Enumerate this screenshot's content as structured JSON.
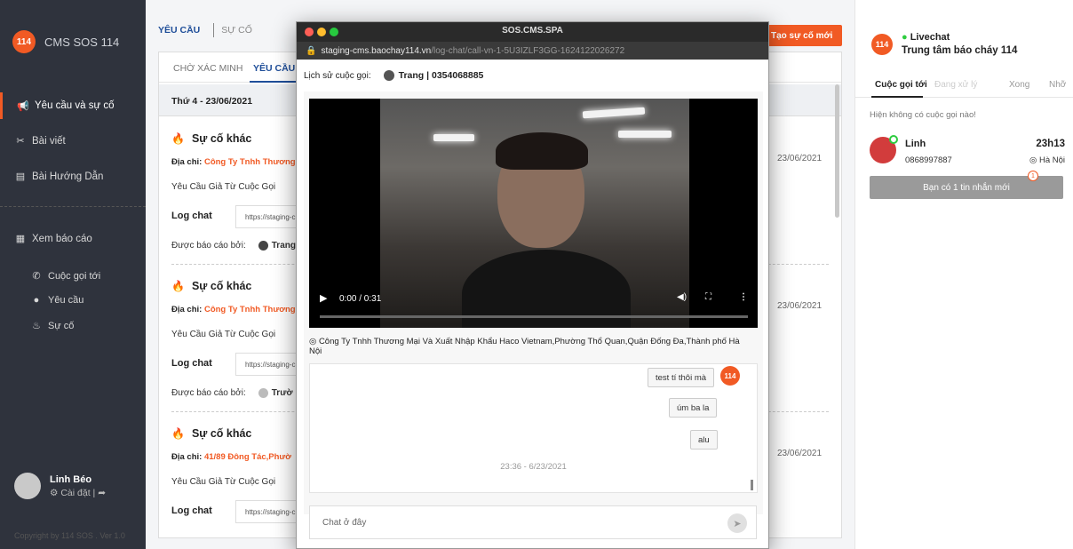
{
  "sidebar": {
    "logo_badge": "114",
    "logo_text": "CMS SOS 114",
    "items": [
      {
        "label": "Yêu cầu và sự cố",
        "icon": "megaphone-icon"
      },
      {
        "label": "Bài viết",
        "icon": "tools-icon"
      },
      {
        "label": "Bài Hướng Dẫn",
        "icon": "document-icon"
      },
      {
        "label": "Xem báo cáo",
        "icon": "report-icon"
      }
    ],
    "subitems": [
      {
        "label": "Cuộc gọi tới",
        "icon": "phone-icon"
      },
      {
        "label": "Yêu cầu",
        "icon": "chat-icon"
      },
      {
        "label": "Sự cố",
        "icon": "flame-icon"
      }
    ],
    "user": {
      "name": "Linh Béo",
      "settings": "Cài đặt"
    },
    "copyright": "Copyright by 114 SOS . Ver 1.0"
  },
  "main": {
    "tabs": [
      "YÊU CẦU",
      "SỰ CỐ"
    ],
    "new_button": "Tạo sự cố mới",
    "subtabs": [
      "CHỜ XÁC MINH",
      "YÊU CẦU"
    ],
    "date_header": "Thứ 4 - 23/06/2021",
    "incidents": [
      {
        "title": "Sự cố khác",
        "address_label": "Địa chỉ:",
        "address": "Công Ty Tnhh Thương",
        "request": "Yêu Cầu Giả Từ Cuộc Gọi",
        "log_label": "Log chat",
        "log_url": "https://staging-c",
        "reporter_label": "Được báo cáo bởi:",
        "reporter": "Trang",
        "date": "23/06/2021"
      },
      {
        "title": "Sự cố khác",
        "address_label": "Địa chỉ:",
        "address": "Công Ty Tnhh Thương",
        "request": "Yêu Cầu Giả Từ Cuộc Gọi",
        "log_label": "Log chat",
        "log_url": "https://staging-c",
        "reporter_label": "Được báo cáo bởi:",
        "reporter": "Trườ",
        "date": "23/06/2021"
      },
      {
        "title": "Sự cố khác",
        "address_label": "Địa chỉ:",
        "address": "41/89 Đông Tác,Phườ",
        "request": "Yêu Cầu Giả Từ Cuộc Gọi",
        "log_label": "Log chat",
        "log_url": "https://staging-c",
        "reporter_label": "",
        "reporter": "",
        "date": "23/06/2021"
      }
    ]
  },
  "popup": {
    "window_title": "SOS.CMS.SPA",
    "url_host": "staging-cms.baochay114.vn",
    "url_path": "/log-chat/call-vn-1-5U3IZLF3GG-1624122026272",
    "history_label": "Lịch sử cuộc gọi:",
    "caller_name": "Trang",
    "caller_phone": "0354068885",
    "video_time": "0:00 / 0:31",
    "video_progress": 0,
    "address": "Công Ty Tnhh Thương Mại Và Xuất Nhập Khẩu Haco Vietnam,Phường Thổ Quan,Quận Đống Đa,Thành phố Hà Nội",
    "messages": [
      "test tí thôi mà",
      "úm ba la",
      "alu"
    ],
    "chat_avatar": "114",
    "chat_time": "23:36 - 6/23/2021",
    "input_placeholder": "Chat ở đây"
  },
  "right": {
    "badge": "114",
    "status": "Livechat",
    "center_name": "Trung tâm báo cháy 114",
    "tabs": [
      "Cuộc gọi tới",
      "Đang xử lý",
      "Xong",
      "Nhỡ"
    ],
    "no_calls": "Hiện không có cuộc gọi nào!",
    "call": {
      "name": "Linh",
      "phone": "0868997887",
      "time": "23h13",
      "location": "Hà Nội"
    },
    "message_button": "Bạn có 1 tin nhắn mới",
    "message_count": "1"
  },
  "colors": {
    "accent": "#f15a24",
    "sidebar_bg": "#2f333d",
    "primary_blue": "#1f4e99",
    "online": "#2ecc40"
  }
}
